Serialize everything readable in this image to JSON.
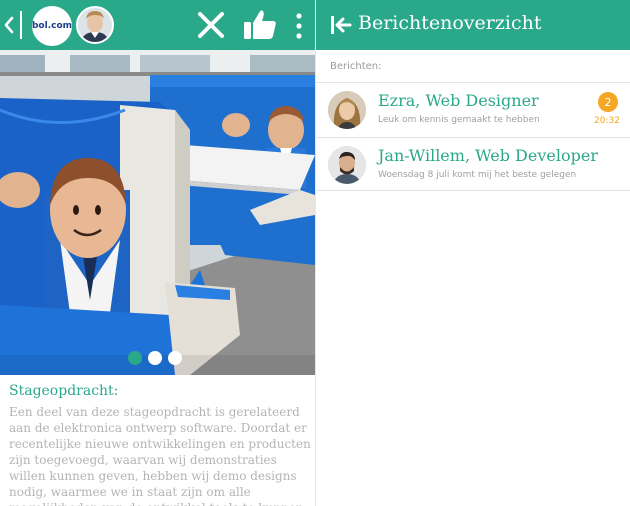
{
  "colors": {
    "brand": "#2aa88a",
    "badge": "#f5a623",
    "muted_text": "#b4b4b4"
  },
  "profile": {
    "topbar": {
      "logo_text": "bol.com",
      "icons": [
        "chevron-left-icon",
        "close-icon",
        "thumbs-up-icon",
        "more-vertical-icon"
      ]
    },
    "carousel": {
      "slide_count": 3,
      "active_index": 0
    },
    "assignment": {
      "title": "Stageopdracht:",
      "body": "Een deel van deze stageopdracht is gerelateerd aan de elektronica ontwerp software. Doordat er recentelijke nieuwe ontwikkelingen en producten zijn toegevoegd, waarvan wij demonstraties willen kunnen geven, hebben wij demo designs nodig, waarmee we in staat zijn om alle mogelijkheden van de ontwikkel tools te kunnen demonstreren."
    }
  },
  "messages_panel": {
    "title": "Berichtenoverzicht",
    "caption": "Berichten:",
    "items": [
      {
        "name": "Ezra, Web Designer",
        "preview": "Leuk om kennis gemaakt te hebben",
        "unread": "2",
        "time": "20:32"
      },
      {
        "name": "Jan-Willem, Web Developer",
        "preview": "Woensdag 8 juli komt mij het beste gelegen"
      }
    ]
  }
}
